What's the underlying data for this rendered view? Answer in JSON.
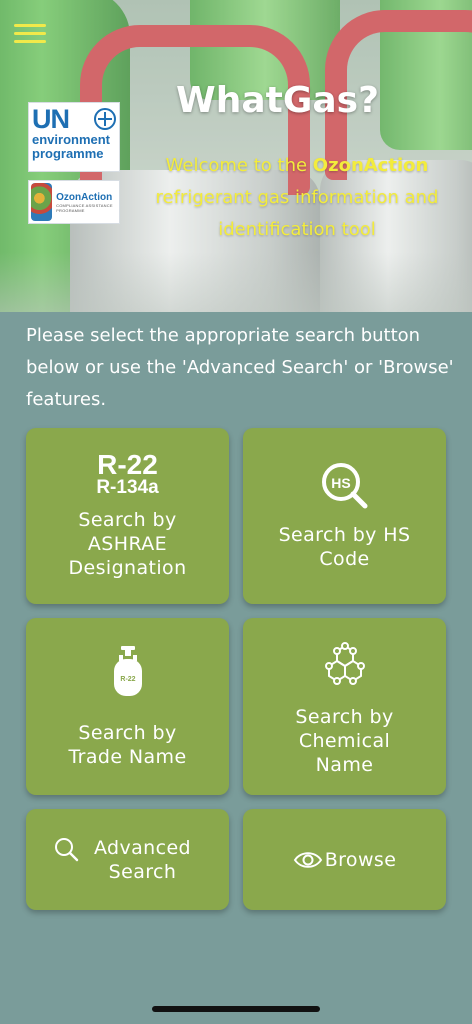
{
  "app": {
    "title": "WhatGas?",
    "welcome_pre": "Welcome to the ",
    "welcome_brand": "OzonAction",
    "welcome_post": " refrigerant gas information and identification tool"
  },
  "logos": {
    "un_mark": "UN",
    "un_line1": "environment",
    "un_line2": "programme",
    "ozon_name": "OzonAction",
    "ozon_sub": "COMPLIANCE ASSISTANCE PROGRAMME"
  },
  "intro": "Please select the appropriate search button below or use the 'Advanced Search' or 'Browse' features.",
  "tiles": {
    "ashrae": {
      "icon_big": "R-22",
      "icon_small": "R-134a",
      "label": "Search by ASHRAE Designation"
    },
    "hs": {
      "icon_text": "HS",
      "label": "Search by HS Code"
    },
    "trade": {
      "icon_text": "R-22",
      "label": "Search by Trade Name"
    },
    "chemical": {
      "label": "Search by Chemical Name"
    },
    "advanced": {
      "label": "Advanced Search"
    },
    "browse": {
      "label": "Browse"
    }
  },
  "colors": {
    "tile": "#8aa84c",
    "background": "#7a9c9a",
    "accent_yellow": "#f3ec3c"
  },
  "icons": [
    "menu-icon",
    "hs-search-icon",
    "gas-cylinder-icon",
    "molecule-icon",
    "search-icon",
    "eye-icon"
  ]
}
